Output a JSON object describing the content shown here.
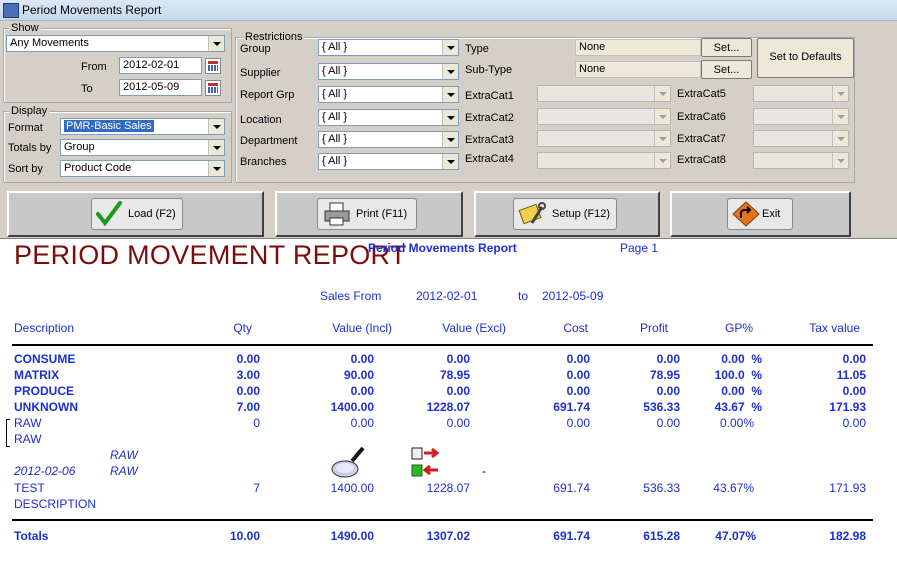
{
  "window": {
    "title": "Period Movements Report"
  },
  "show": {
    "legend": "Show",
    "movement_value": "Any Movements",
    "from_label": "From",
    "from_value": "2012-02-01",
    "to_label": "To",
    "to_value": "2012-05-09"
  },
  "display": {
    "legend": "Display",
    "format_label": "Format",
    "format_value": "PMR-Basic Sales",
    "totals_label": "Totals by",
    "totals_value": "Group",
    "sort_label": "Sort by",
    "sort_value": "Product Code"
  },
  "restrictions": {
    "legend": "Restrictions",
    "group_label": "Group",
    "group_value": "{ All }",
    "supplier_label": "Supplier",
    "supplier_value": "{ All }",
    "reportgrp_label": "Report Grp",
    "reportgrp_value": "{ All }",
    "location_label": "Location",
    "location_value": "{ All }",
    "department_label": "Department",
    "department_value": "{ All }",
    "branches_label": "Branches",
    "branches_value": "{ All }",
    "type_label": "Type",
    "type_value": "None",
    "subtype_label": "Sub-Type",
    "subtype_value": "None",
    "set_label": "Set...",
    "defaults_label": "Set to Defaults",
    "extracat": [
      "ExtraCat1",
      "ExtraCat2",
      "ExtraCat3",
      "ExtraCat4",
      "ExtraCat5",
      "ExtraCat6",
      "ExtraCat7",
      "ExtraCat8"
    ]
  },
  "toolbar": {
    "load_label": "Load (F2)",
    "print_label": "Print (F11)",
    "setup_label": "Setup (F12)",
    "exit_label": "Exit"
  },
  "report": {
    "heading": "PERIOD MOVEMENT REPORT",
    "subtitle": "Period Movements Report",
    "page": "Page 1",
    "sales_from_label": "Sales From",
    "sales_from": "2012-02-01",
    "to_label": "to",
    "sales_to": "2012-05-09",
    "columns": [
      "Description",
      "Qty",
      "Value (Incl)",
      "Value (Excl)",
      "Cost",
      "Profit",
      "GP%",
      "Tax value"
    ],
    "group_rows": [
      {
        "desc": "CONSUME",
        "qty": "0.00",
        "incl": "0.00",
        "excl": "0.00",
        "cost": "0.00",
        "profit": "0.00",
        "gp": "0.00  %",
        "tax": "0.00"
      },
      {
        "desc": "MATRIX",
        "qty": "3.00",
        "incl": "90.00",
        "excl": "78.95",
        "cost": "0.00",
        "profit": "78.95",
        "gp": "100.0  %",
        "tax": "11.05"
      },
      {
        "desc": "PRODUCE",
        "qty": "0.00",
        "incl": "0.00",
        "excl": "0.00",
        "cost": "0.00",
        "profit": "0.00",
        "gp": "0.00  %",
        "tax": "0.00"
      },
      {
        "desc": "UNKNOWN",
        "qty": "7.00",
        "incl": "1400.00",
        "excl": "1228.07",
        "cost": "691.74",
        "profit": "536.33",
        "gp": "43.67  %",
        "tax": "171.93"
      }
    ],
    "raw_row": {
      "desc": "RAW",
      "qty": "0",
      "incl": "0.00",
      "excl": "0.00",
      "cost": "0.00",
      "profit": "0.00",
      "gp": "0.00%",
      "tax": "0.00"
    },
    "raw_line2": "RAW",
    "detail_raw1": "RAW",
    "detail_date": "2012-02-06",
    "detail_raw2": "RAW",
    "detail_dash": "-",
    "detail_row": {
      "desc": "TEST",
      "qty": "7",
      "incl": "1400.00",
      "excl": "1228.07",
      "cost": "691.74",
      "profit": "536.33",
      "gp": "43.67%",
      "tax": "171.93"
    },
    "detail_desc2": "DESCRIPTION",
    "totals": {
      "desc": "Totals",
      "qty": "10.00",
      "incl": "1490.00",
      "excl": "1307.02",
      "cost": "691.74",
      "profit": "615.28",
      "gp": "47.07%",
      "tax": "182.98"
    }
  }
}
